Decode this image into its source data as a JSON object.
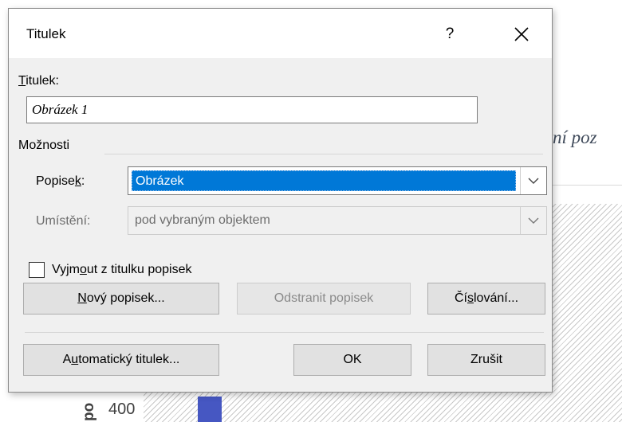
{
  "background": {
    "heading_fragment": "ní poz",
    "axis_label_fragment": "po",
    "tick_label": "400"
  },
  "dialog": {
    "title": "Titulek",
    "help_label": "?",
    "caption_label": {
      "underlined": "T",
      "rest": "itulek:"
    },
    "caption_value": "Obrázek 1",
    "options_group_label": "Možnosti",
    "label_field": {
      "label_pre": "Popise",
      "label_underlined": "k",
      "label_post": ":",
      "selected": "Obrázek"
    },
    "position_field": {
      "label": "Umístění:",
      "selected": "pod vybraným objektem"
    },
    "exclude_label_checkbox": {
      "pre": "Vyjm",
      "underlined": "o",
      "post": "ut z titulku popisek",
      "checked": false
    },
    "buttons": {
      "new_label": {
        "underlined": "N",
        "rest": "ový popisek..."
      },
      "delete_label": "Odstranit popisek",
      "numbering": {
        "pre": "Čí",
        "underlined": "s",
        "post": "lování..."
      },
      "autocaption": {
        "pre": "A",
        "underlined": "u",
        "post": "tomatický titulek..."
      },
      "ok": "OK",
      "cancel": "Zrušit"
    }
  },
  "colors": {
    "selection": "#0078d7",
    "bar": "#4657c2",
    "dialog_bg": "#f0f0f0"
  }
}
